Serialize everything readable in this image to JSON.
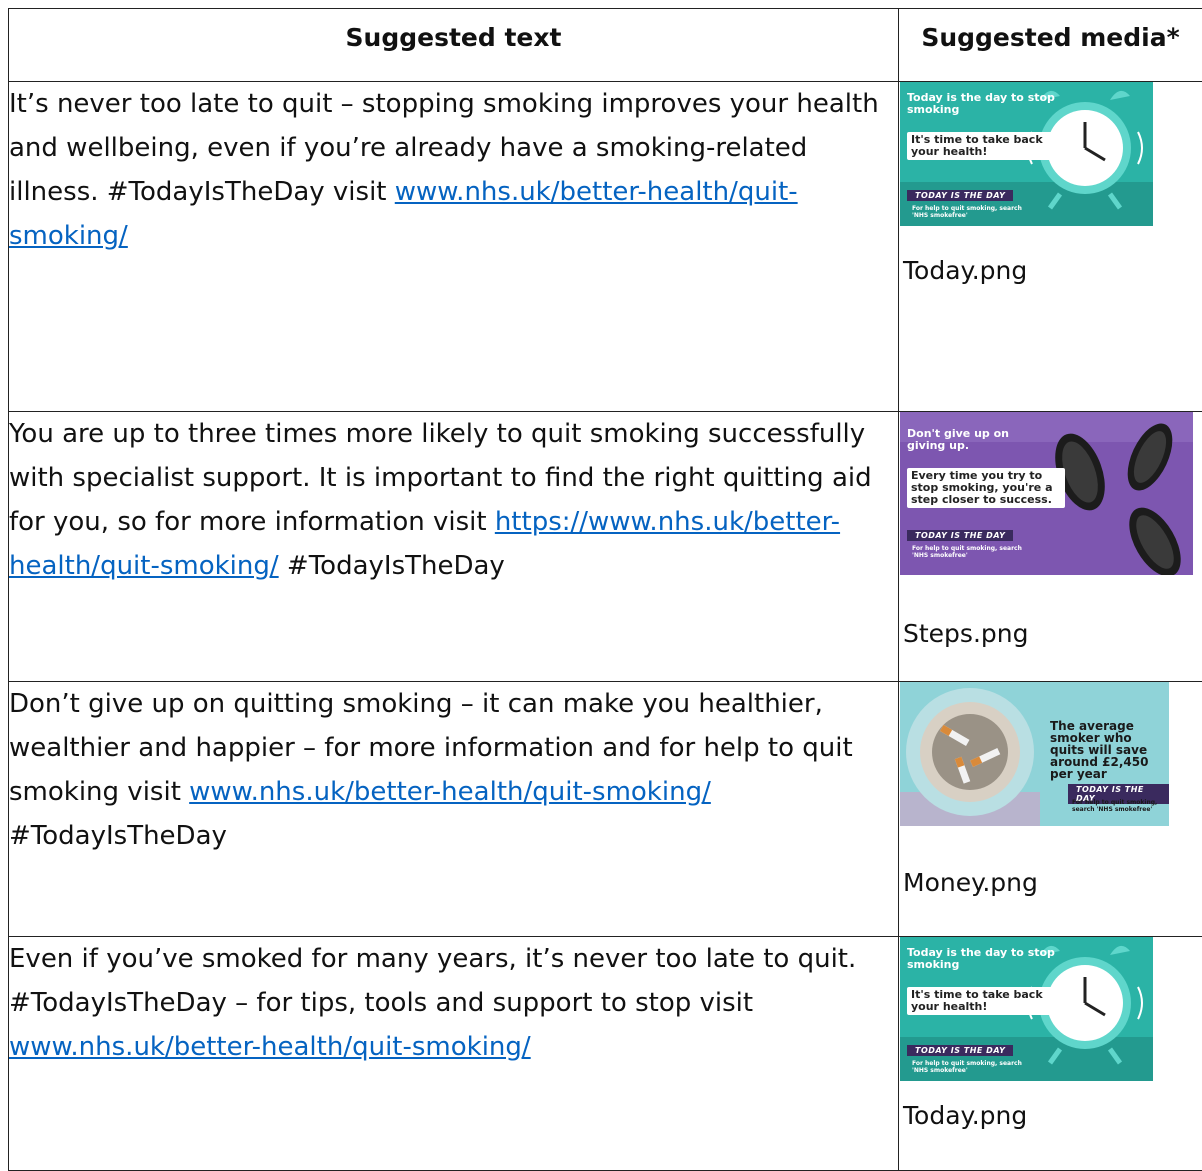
{
  "table": {
    "headers": {
      "text": "Suggested text",
      "media": "Suggested media*"
    },
    "rows": [
      {
        "pre": "It’s never too late to quit – stopping smoking improves your health and wellbeing, even if you’re already have a smoking-related illness. #TodayIsTheDay visit ",
        "link": "www.nhs.uk/better-health/quit-smoking/",
        "post": "",
        "filename": "Today.png"
      },
      {
        "pre": "You are up to three times more likely to quit smoking successfully with specialist support. It is important to find the right quitting aid for you, so for more information visit ",
        "link": "https://www.nhs.uk/better-health/quit-smoking/",
        "post": " #TodayIsTheDay",
        "filename": "Steps.png"
      },
      {
        "pre": "Don’t give up on quitting smoking – it can make you healthier, wealthier and happier – for more information and for help to quit smoking visit ",
        "link": "www.nhs.uk/better-health/quit-smoking/",
        "post": " #TodayIsTheDay",
        "filename": "Money.png"
      },
      {
        "pre": "Even if you’ve smoked for many years, it’s never too late to quit. #TodayIsTheDay – for tips, tools and support to stop visit ",
        "link": "www.nhs.uk/better-health/quit-smoking/",
        "post": "",
        "filename": "Today.png"
      }
    ]
  },
  "thumbs": {
    "today": {
      "headline": "Today is the day to stop smoking",
      "box": "It's time to take back your health!",
      "ribbon": "TODAY IS THE DAY",
      "help": "For help to quit smoking, search 'NHS smokefree'",
      "bg": "#2bb3a6"
    },
    "steps": {
      "headline": "Don't give up on giving up.",
      "box": "Every time you try to stop smoking, you're a step closer to success.",
      "ribbon": "TODAY IS THE DAY",
      "help": "For help to quit smoking, search 'NHS smokefree'",
      "bg": "#7d56b0"
    },
    "money": {
      "headline": "The average smoker who quits will save around £2,450 per year",
      "ribbon": "TODAY IS THE DAY",
      "help": "For help to quit smoking, search 'NHS smokefree'",
      "bg": "#8fd3d8"
    }
  }
}
